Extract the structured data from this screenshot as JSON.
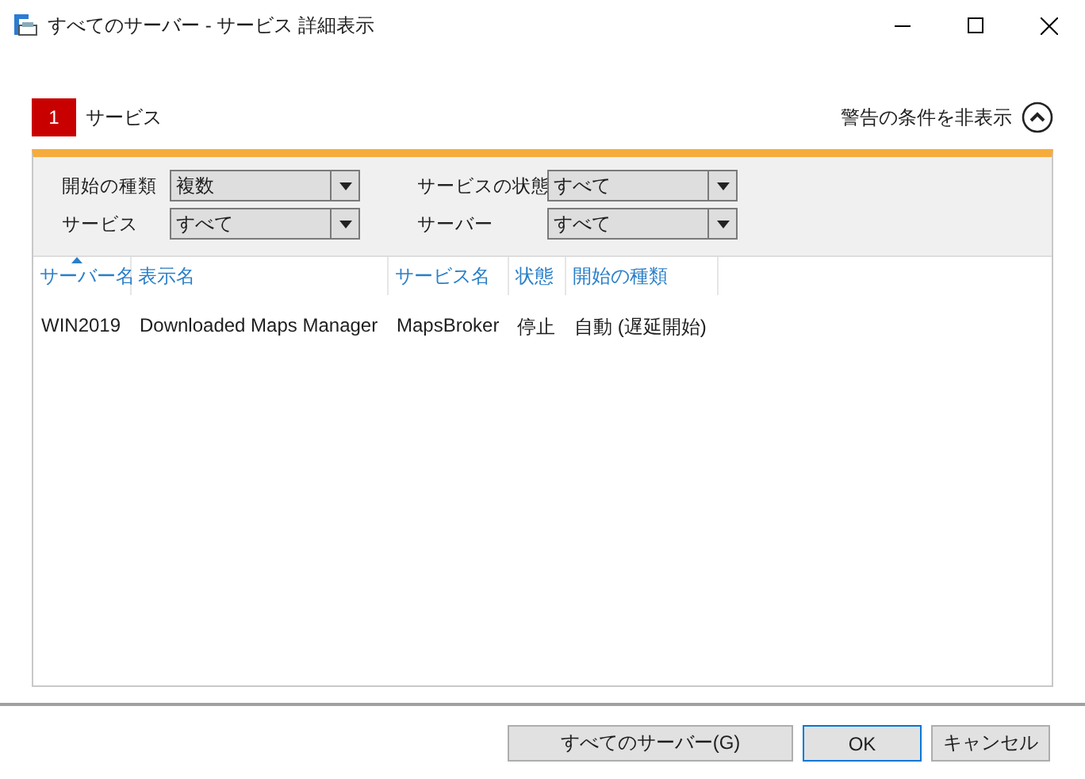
{
  "window": {
    "title": "すべてのサーバー - サービス 詳細表示"
  },
  "section": {
    "number": "1",
    "title": "サービス",
    "toggle_label": "警告の条件を非表示",
    "expanded": true
  },
  "filters": [
    {
      "label": "開始の種類",
      "value": "複数"
    },
    {
      "label": "サービスの状態",
      "value": "すべて"
    },
    {
      "label": "サービス",
      "value": "すべて"
    },
    {
      "label": "サーバー",
      "value": "すべて"
    }
  ],
  "table": {
    "columns": [
      {
        "label": "サーバー名",
        "sorted": true
      },
      {
        "label": "表示名",
        "sorted": false
      },
      {
        "label": "サービス名",
        "sorted": false
      },
      {
        "label": "状態",
        "sorted": false
      },
      {
        "label": "開始の種類",
        "sorted": false
      }
    ],
    "rows": [
      [
        "WIN2019",
        "Downloaded Maps Manager",
        "MapsBroker",
        "停止",
        "自動 (遅延開始)"
      ]
    ]
  },
  "buttons": [
    {
      "label": "すべてのサーバー(G)",
      "default": false
    },
    {
      "label": "OK",
      "default": true
    },
    {
      "label": "キャンセル",
      "default": false
    }
  ]
}
